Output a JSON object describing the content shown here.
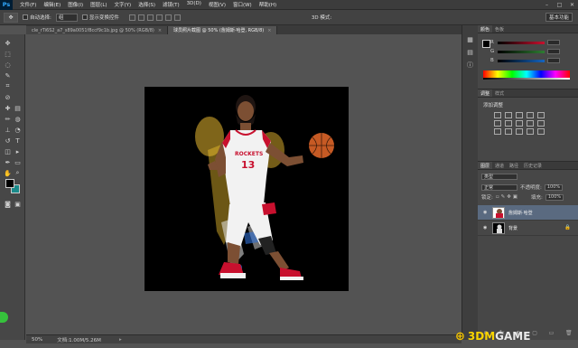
{
  "app": {
    "logo": "Ps"
  },
  "menu": [
    "文件(F)",
    "编辑(E)",
    "图像(I)",
    "图层(L)",
    "文字(Y)",
    "选择(S)",
    "滤镜(T)",
    "3D(D)",
    "视图(V)",
    "窗口(W)",
    "帮助(H)"
  ],
  "window_controls": [
    "–",
    "□",
    "✕"
  ],
  "options": {
    "auto_select_label": "自动选择:",
    "auto_select_value": "组",
    "show_transform_label": "显示变换控件",
    "threed_mode_label": "3D 模式:",
    "workspace": "基本功能"
  },
  "tabs": [
    {
      "label": "cle_rTi6S2_a7_s89a0051f8ccf9c1b.jpg @ 50% (RGB/8)",
      "close": "×"
    },
    {
      "label": "球员照片截图 @ 50% (詹姆斯·哈登, RGB/8)",
      "close": "×"
    }
  ],
  "status": {
    "zoom": "50%",
    "doc": "文档:1.00M/5.26M",
    "arrow": "▸"
  },
  "color_panel": {
    "tabs": [
      "颜色",
      "色板"
    ],
    "rows": [
      {
        "label": "R",
        "color": "#c8102e"
      },
      {
        "label": "G",
        "color": "#2e7d32"
      },
      {
        "label": "B",
        "color": "#1565c0"
      }
    ]
  },
  "adjust_panel": {
    "tabs": [
      "调整",
      "样式"
    ],
    "title": "添加调整"
  },
  "layers_panel": {
    "tabs": [
      "图层",
      "通道",
      "路径",
      "历史记录"
    ],
    "kind": "类型",
    "blend": "正常",
    "opacity_label": "不透明度:",
    "opacity_value": "100%",
    "lock_label": "锁定:",
    "fill_label": "填充:",
    "fill_value": "100%",
    "layers": [
      {
        "name": "詹姆斯·哈登",
        "selected": true
      },
      {
        "name": "背景",
        "selected": false
      }
    ],
    "bottom_icons": [
      "⊖",
      "fx",
      "◐",
      "▢",
      "▭",
      "🗑"
    ]
  },
  "watermark": {
    "mark": "⊕",
    "brand": "3DM",
    "suffix": "GAME"
  },
  "colors": {
    "canvas_bg": "#000000",
    "jersey": "#f2f2f2",
    "jersey_red": "#c8102e",
    "skin": "#8a5a3c",
    "ball": "#c65a24",
    "blur_yellow": "#e8b830"
  }
}
